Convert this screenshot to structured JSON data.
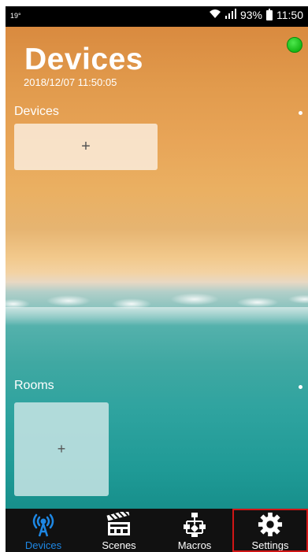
{
  "status_bar": {
    "left_text": "19°",
    "battery": "93%",
    "time": "11:50"
  },
  "header": {
    "title": "Devices",
    "datetime": "2018/12/07 11:50:05",
    "connection_status_color": "#22cc22"
  },
  "sections": {
    "devices_label": "Devices",
    "devices_add": "+",
    "rooms_label": "Rooms",
    "rooms_add": "+"
  },
  "nav": {
    "active": "Devices",
    "items": [
      {
        "label": "Devices",
        "icon": "antenna-icon"
      },
      {
        "label": "Scenes",
        "icon": "clapperboard-icon"
      },
      {
        "label": "Macros",
        "icon": "flowchart-icon"
      },
      {
        "label": "Settings",
        "icon": "gear-icon"
      }
    ]
  },
  "colors": {
    "accent": "#1e88e5",
    "highlight_border": "#d01616"
  }
}
